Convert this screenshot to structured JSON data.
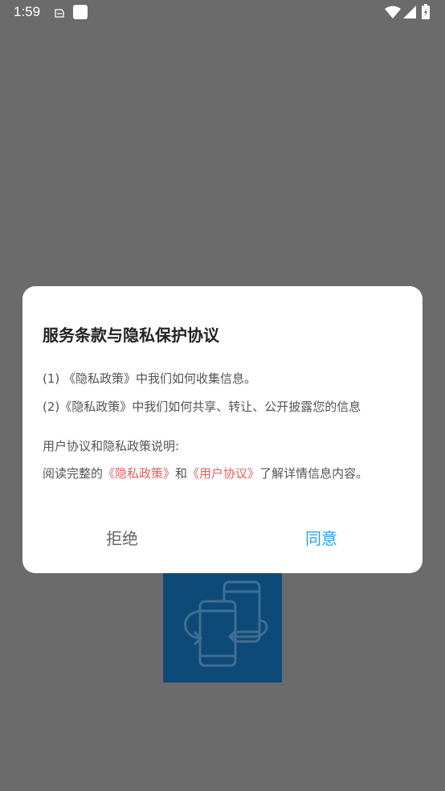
{
  "status_bar": {
    "time": "1:59",
    "icons": [
      "notification-icon",
      "app-icon",
      "wifi-icon",
      "signal-icon",
      "battery-icon"
    ]
  },
  "app": {
    "logo": "phone-transfer-logo",
    "logo_color": "#0e4a78"
  },
  "dialog": {
    "title": "服务条款与隐私保护协议",
    "line1": "(1) 《隐私政策》中我们如何收集信息。",
    "line2": "(2)《隐私政策》中我们如何共享、转让、公开披露您的信息",
    "section_heading": "用户协议和隐私政策说明:",
    "read_prefix": "阅读完整的",
    "privacy_link": "《隐私政策》",
    "and_text": "和",
    "user_agreement_link": "《用户协议》",
    "read_suffix": "了解详情信息内容。",
    "reject_label": "拒绝",
    "agree_label": "同意"
  },
  "colors": {
    "overlay": "#6b6b6b",
    "link": "#e85d5d",
    "accent": "#2aa3e0"
  }
}
